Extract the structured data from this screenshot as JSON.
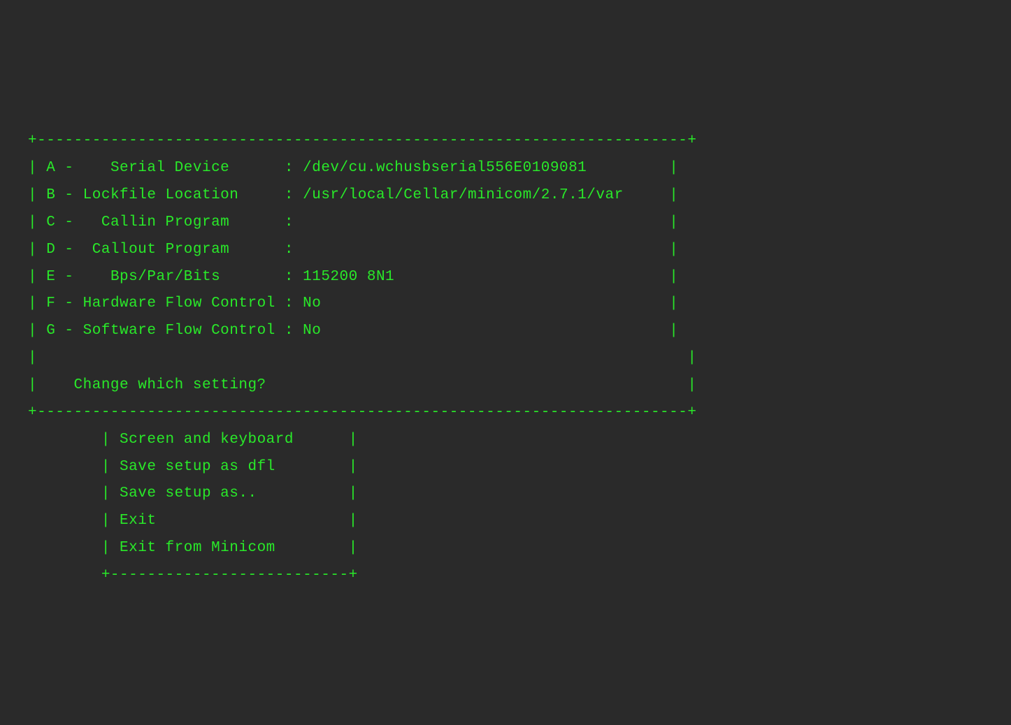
{
  "top_box": {
    "border_top": "+-----------------------------------------------------------------------+",
    "rows": [
      {
        "pre": "| ",
        "key": "A",
        "sep": " -    ",
        "label": "Serial Device",
        "space_after_label": "      ",
        "colon": ":",
        "space_after_colon": " ",
        "value": "/dev/cu.wchusbserial556E0109081",
        "pad_to_bar": "         ",
        "bar": "|"
      },
      {
        "pre": "| ",
        "key": "B",
        "sep": " - ",
        "label": "Lockfile Location",
        "space_after_label": "     ",
        "colon": ":",
        "space_after_colon": " ",
        "value": "/usr/local/Cellar/minicom/2.7.1/var",
        "pad_to_bar": "     ",
        "bar": "|"
      },
      {
        "pre": "| ",
        "key": "C",
        "sep": " -   ",
        "label": "Callin Program",
        "space_after_label": "      ",
        "colon": ":",
        "space_after_colon": "",
        "value": "",
        "pad_to_bar": "                                         ",
        "bar": "|"
      },
      {
        "pre": "| ",
        "key": "D",
        "sep": " -  ",
        "label": "Callout Program",
        "space_after_label": "      ",
        "colon": ":",
        "space_after_colon": "",
        "value": "",
        "pad_to_bar": "                                         ",
        "bar": "|"
      },
      {
        "pre": "| ",
        "key": "E",
        "sep": " -    ",
        "label": "Bps/Par/Bits",
        "space_after_label": "       ",
        "colon": ":",
        "space_after_colon": " ",
        "value": "115200 8N1",
        "pad_to_bar": "                              ",
        "bar": "|"
      },
      {
        "pre": "| ",
        "key": "F",
        "sep": " - ",
        "label": "Hardware Flow Control",
        "space_after_label": " ",
        "colon": ":",
        "space_after_colon": " ",
        "value": "No",
        "pad_to_bar": "                                      ",
        "bar": "|"
      },
      {
        "pre": "| ",
        "key": "G",
        "sep": " - ",
        "label": "Software Flow Control",
        "space_after_label": " ",
        "colon": ":",
        "space_after_colon": " ",
        "value": "No",
        "pad_to_bar": "                                      ",
        "bar": "|"
      }
    ],
    "blank_row": "|                                                                       |",
    "prompt_row_pre": "|    ",
    "prompt_text": "Change which setting?",
    "prompt_row_post": "                                              |",
    "border_bottom": "+-----------------------------------------------------------------------+"
  },
  "bottom_box": {
    "indent": "        ",
    "items": [
      {
        "text": "Screen and keyboard",
        "pad": "      "
      },
      {
        "text": "Save setup as dfl",
        "pad": "        "
      },
      {
        "text": "Save setup as..",
        "pad": "          "
      },
      {
        "text": "Exit",
        "pad": "                     "
      },
      {
        "text": "Exit from Minicom",
        "pad": "        "
      }
    ],
    "border_bottom": "+--------------------------+"
  }
}
